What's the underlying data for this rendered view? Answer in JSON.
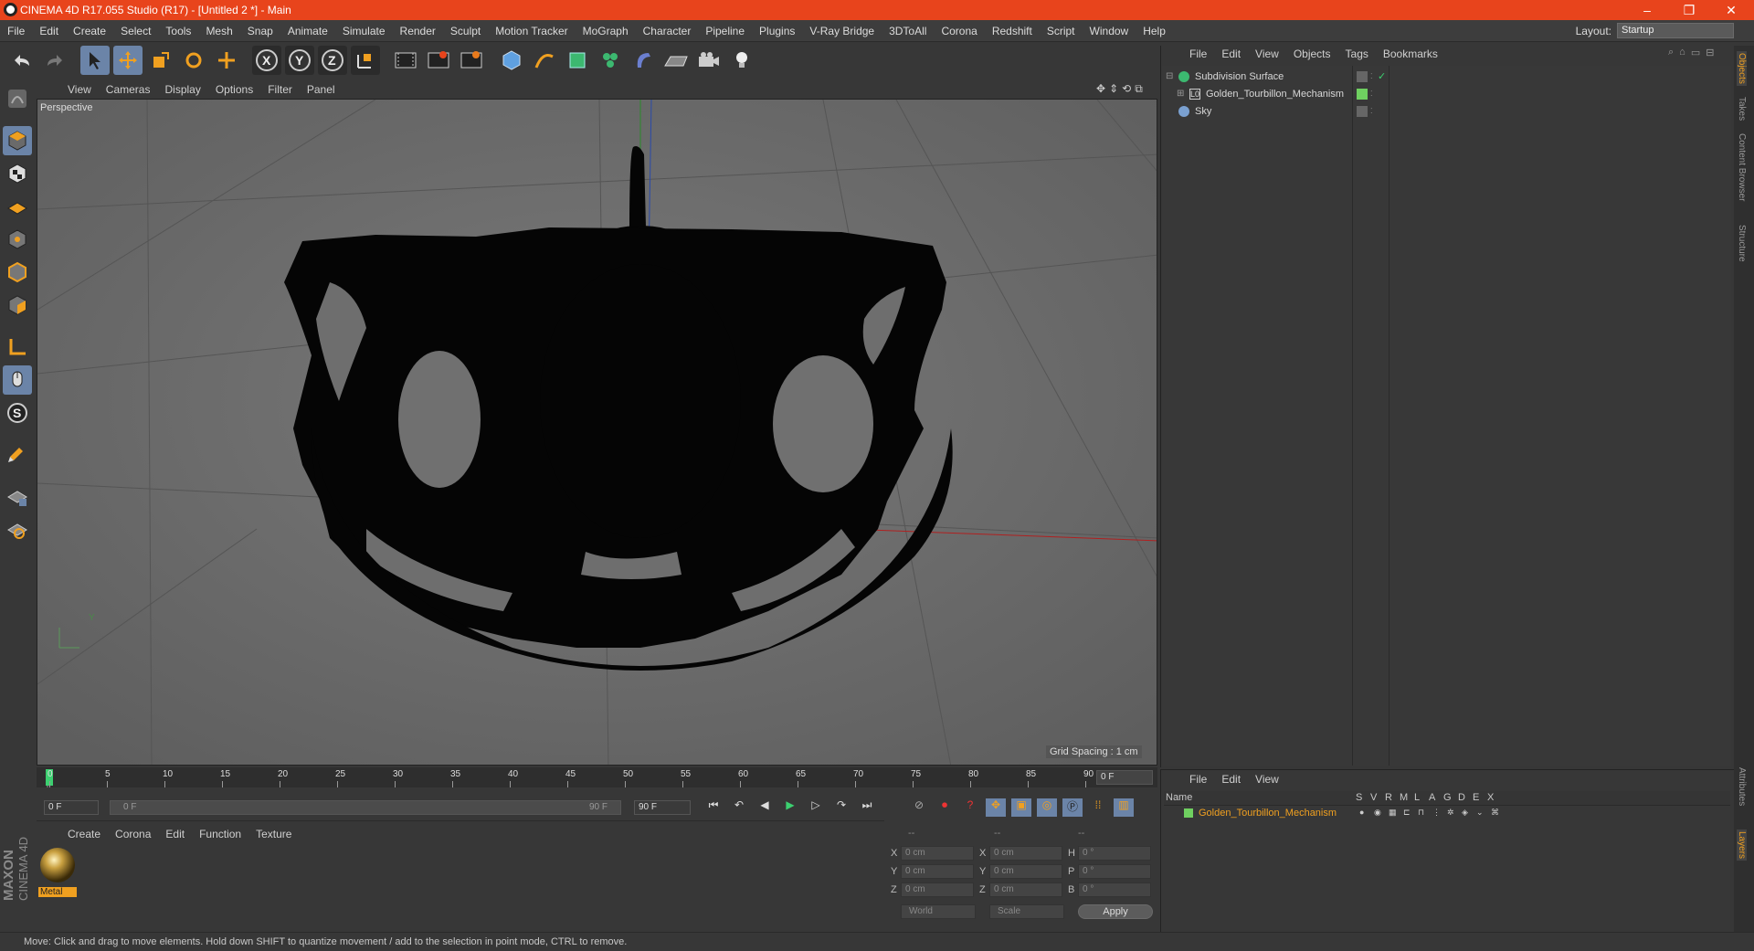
{
  "window": {
    "title": "CINEMA 4D R17.055 Studio (R17) - [Untitled 2 *] - Main",
    "min": "–",
    "restore": "❐",
    "close": "✕"
  },
  "menubar": [
    "File",
    "Edit",
    "Create",
    "Select",
    "Tools",
    "Mesh",
    "Snap",
    "Animate",
    "Simulate",
    "Render",
    "Sculpt",
    "Motion Tracker",
    "MoGraph",
    "Character",
    "Pipeline",
    "Plugins",
    "V-Ray Bridge",
    "3DToAll",
    "Corona",
    "Redshift",
    "Script",
    "Window",
    "Help"
  ],
  "layout": {
    "label": "Layout:",
    "value": "Startup"
  },
  "viewport": {
    "menu": [
      "View",
      "Cameras",
      "Display",
      "Options",
      "Filter",
      "Panel"
    ],
    "label": "Perspective",
    "grid_spacing": "Grid Spacing : 1 cm"
  },
  "timeline": {
    "ticks": [
      "0",
      "5",
      "10",
      "15",
      "20",
      "25",
      "30",
      "35",
      "40",
      "45",
      "50",
      "55",
      "60",
      "65",
      "70",
      "75",
      "80",
      "85",
      "90"
    ],
    "current_frame": "0 F",
    "start": "0 F",
    "range_start": "0 F",
    "range_end": "90 F",
    "end": "90 F"
  },
  "material": {
    "menu": [
      "Create",
      "Corona",
      "Edit",
      "Function",
      "Texture"
    ],
    "items": [
      {
        "name": "Metal"
      }
    ]
  },
  "coords": {
    "headers": [
      "--",
      "--",
      "--"
    ],
    "rows": [
      {
        "l1": "X",
        "v1": "0 cm",
        "l2": "X",
        "v2": "0 cm",
        "l3": "H",
        "v3": "0 °"
      },
      {
        "l1": "Y",
        "v1": "0 cm",
        "l2": "Y",
        "v2": "0 cm",
        "l3": "P",
        "v3": "0 °"
      },
      {
        "l1": "Z",
        "v1": "0 cm",
        "l2": "Z",
        "v2": "0 cm",
        "l3": "B",
        "v3": "0 °"
      }
    ],
    "world": "World",
    "scale": "Scale",
    "apply": "Apply"
  },
  "objects": {
    "menu": [
      "File",
      "Edit",
      "View",
      "Objects",
      "Tags",
      "Bookmarks"
    ],
    "items": [
      {
        "name": "Subdivision Surface"
      },
      {
        "name": "Golden_Tourbillon_Mechanism"
      },
      {
        "name": "Sky"
      }
    ]
  },
  "layers": {
    "menu": [
      "File",
      "Edit",
      "View"
    ],
    "header_name": "Name",
    "columns": [
      "S",
      "V",
      "R",
      "M",
      "L",
      "A",
      "G",
      "D",
      "E",
      "X"
    ],
    "items": [
      {
        "name": "Golden_Tourbillon_Mechanism",
        "color": "#f0a020"
      }
    ]
  },
  "side_tabs": [
    "Objects",
    "Takes",
    "Content Browser",
    "Structure",
    "Attributes",
    "Layers"
  ],
  "branding": {
    "line1": "MAXON",
    "line2": "CINEMA 4D"
  },
  "status": "Move: Click and drag to move elements. Hold down SHIFT to quantize movement / add to the selection in point mode, CTRL to remove.",
  "colors": {
    "titlebar": "#e8441c",
    "accent": "#6b84a8",
    "layer_text": "#f0a020"
  }
}
